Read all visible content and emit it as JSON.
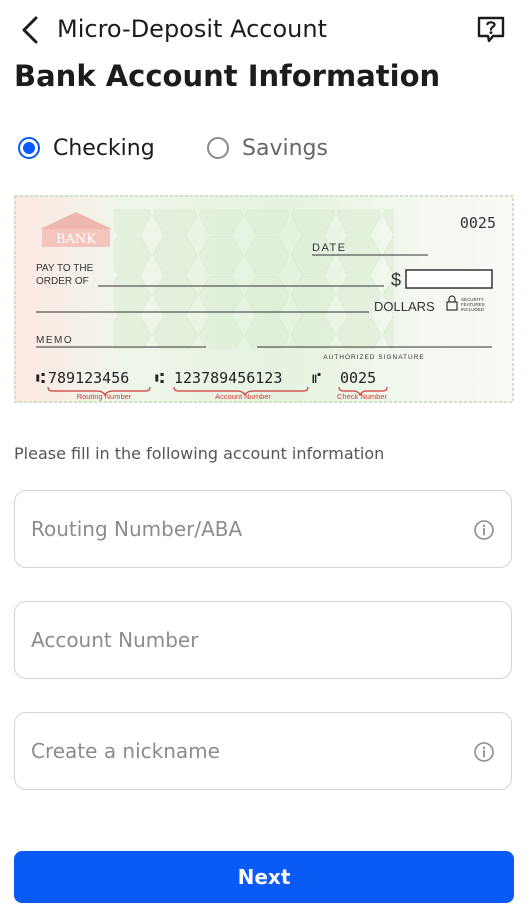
{
  "header": {
    "title": "Micro-Deposit Account",
    "back_icon": "chevron-left-icon",
    "help_icon": "question-box-icon"
  },
  "page_title": "Bank Account Information",
  "account_type": {
    "options": [
      {
        "label": "Checking",
        "selected": true
      },
      {
        "label": "Savings",
        "selected": false
      }
    ]
  },
  "check": {
    "check_no": "0025",
    "bank_name": "BANK",
    "date_label": "DATE",
    "pay_to_line1": "PAY TO THE",
    "pay_to_line2": "ORDER OF",
    "dollar_sign": "$",
    "dollars_label": "DOLLARS",
    "security_line1": "SECURITY",
    "security_line2": "FEATURES",
    "security_line3": "INCLUDED",
    "memo_label": "MEMO",
    "signature_label": "AUTHORIZED SIGNATURE",
    "micr_routing": "789123456",
    "micr_account": "123789456123",
    "micr_check": "0025",
    "routing_caption": "Routing Number",
    "account_caption": "Account Number",
    "check_caption": "Check Number"
  },
  "instruction": "Please fill in the following account information",
  "fields": {
    "routing": {
      "placeholder": "Routing Number/ABA",
      "value": ""
    },
    "account": {
      "placeholder": "Account Number",
      "value": ""
    },
    "nickname": {
      "placeholder": "Create a nickname",
      "value": ""
    }
  },
  "next_label": "Next",
  "colors": {
    "primary": "#0a5bf5",
    "caption_red": "#d23a3a"
  }
}
